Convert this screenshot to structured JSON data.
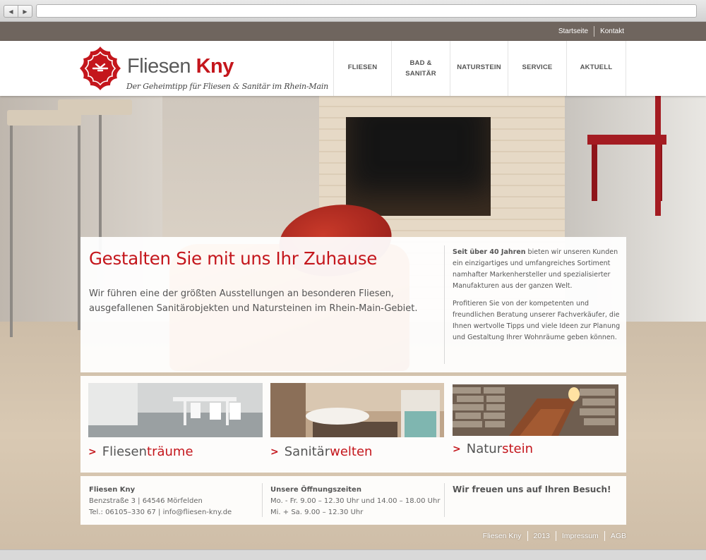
{
  "topbar": {
    "links": [
      "Startseite",
      "Kontakt"
    ]
  },
  "logo": {
    "name_part1": "Fliesen",
    "name_part2": "Kny",
    "tagline": "Der Geheimtipp für Fliesen & Sanitär im Rhein-Main"
  },
  "nav": {
    "items": [
      "FLIESEN",
      "BAD & SANITÄR",
      "NATURSTEIN",
      "SERVICE",
      "AKTUELL"
    ]
  },
  "intro": {
    "headline": "Gestalten Sie mit uns Ihr Zuhause",
    "lead": "Wir führen eine der größten Ausstellungen an besonderen Fliesen, ausgefallenen Sanitärobjekten und Natursteinen im Rhein-Main-Gebiet.",
    "side_bold": "Seit über 40 Jahren",
    "side_p1_rest": " bieten wir unseren Kunden ein einzigartiges und umfangreiches Sortiment namhafter Markenhersteller und spezialisierter Manufakturen aus der ganzen Welt.",
    "side_p2": "Profitieren Sie von der kompetenten und freundlichen Beratung unserer Fachverkäufer, die Ihnen wertvolle Tipps und viele Ideen zur Planung und Gestaltung Ihrer Wohnräume geben können."
  },
  "categories": [
    {
      "prefix": "Fliesen",
      "highlight": "träume"
    },
    {
      "prefix": "Sanitär",
      "highlight": "welten"
    },
    {
      "prefix": "Natur",
      "highlight": "stein"
    }
  ],
  "info": {
    "company": "Fliesen Kny",
    "address": "Benzstraße 3 | 64546 Mörfelden",
    "contact": "Tel.: 06105–330 67 | info@fliesen-kny.de",
    "hours_title": "Unsere Öffnungszeiten",
    "hours_weekday": "Mo. - Fr. 9.00 – 12.30 Uhr und 14.00 – 18.00 Uhr",
    "hours_saturday": "Mi. + Sa. 9.00 – 12.30 Uhr",
    "greeting": "Wir freuen uns auf Ihren Besuch!"
  },
  "footer": {
    "links": [
      "Fliesen Kny",
      "2013",
      "Impressum",
      "AGB"
    ]
  },
  "colors": {
    "brand_red": "#c4161c",
    "topbar": "#6f655e",
    "text": "#555555"
  },
  "icons": {
    "browser_back": "back-arrow-icon",
    "browser_forward": "forward-arrow-icon",
    "logo": "ornament-logo-icon",
    "category_link": "chevron-right-icon"
  }
}
